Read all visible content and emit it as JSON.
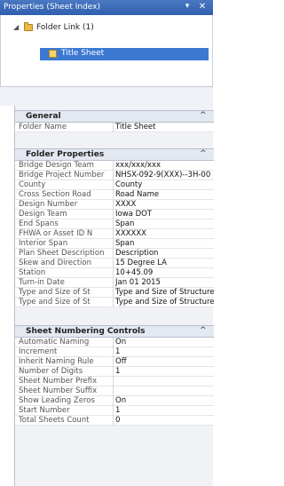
{
  "titlebar": {
    "title": "Properties (Sheet Index)",
    "pin": "▾",
    "close": "✕"
  },
  "tree": {
    "folder_label": "Folder Link (1)",
    "sheet_label": "Title Sheet"
  },
  "sections": {
    "general": {
      "title": "General",
      "rows": [
        {
          "k": "Folder Name",
          "v": "Title Sheet"
        }
      ]
    },
    "folder": {
      "title": "Folder Properties",
      "rows": [
        {
          "k": "Bridge Design Team",
          "v": "xxx/xxx/xxx"
        },
        {
          "k": "Bridge Project Number",
          "v": "NHSX-092-9(XXX)--3H-00"
        },
        {
          "k": "County",
          "v": "County"
        },
        {
          "k": "Cross Section Road",
          "v": "Road Name"
        },
        {
          "k": "Design Number",
          "v": "XXXX"
        },
        {
          "k": "Design Team",
          "v": "Iowa DOT"
        },
        {
          "k": "End Spans",
          "v": "Span"
        },
        {
          "k": "FHWA or Asset ID N",
          "v": "XXXXXX"
        },
        {
          "k": "Interior Span",
          "v": "Span"
        },
        {
          "k": "Plan Sheet Description",
          "v": "Description"
        },
        {
          "k": "Skew and Direction",
          "v": "15 Degree LA"
        },
        {
          "k": "Station",
          "v": "10+45.09"
        },
        {
          "k": "Turn-in Date",
          "v": "Jan 01 2015"
        },
        {
          "k": "Type and Size of St",
          "v": "Type and Size of Structure"
        },
        {
          "k": "Type and Size of St",
          "v": "Type and Size of Structure"
        }
      ]
    },
    "numbering": {
      "title": "Sheet Numbering Controls",
      "rows": [
        {
          "k": "Automatic Naming",
          "v": "On"
        },
        {
          "k": "Increment",
          "v": "1"
        },
        {
          "k": "Inherit Naming Rule",
          "v": "Off"
        },
        {
          "k": "Number of Digits",
          "v": "1"
        },
        {
          "k": "Sheet Number Prefix",
          "v": ""
        },
        {
          "k": "Sheet Number Suffix",
          "v": ""
        },
        {
          "k": "Show Leading Zeros",
          "v": "On"
        },
        {
          "k": "Start Number",
          "v": "1"
        },
        {
          "k": "Total Sheets Count",
          "v": "0"
        }
      ]
    }
  },
  "chevron": "^"
}
